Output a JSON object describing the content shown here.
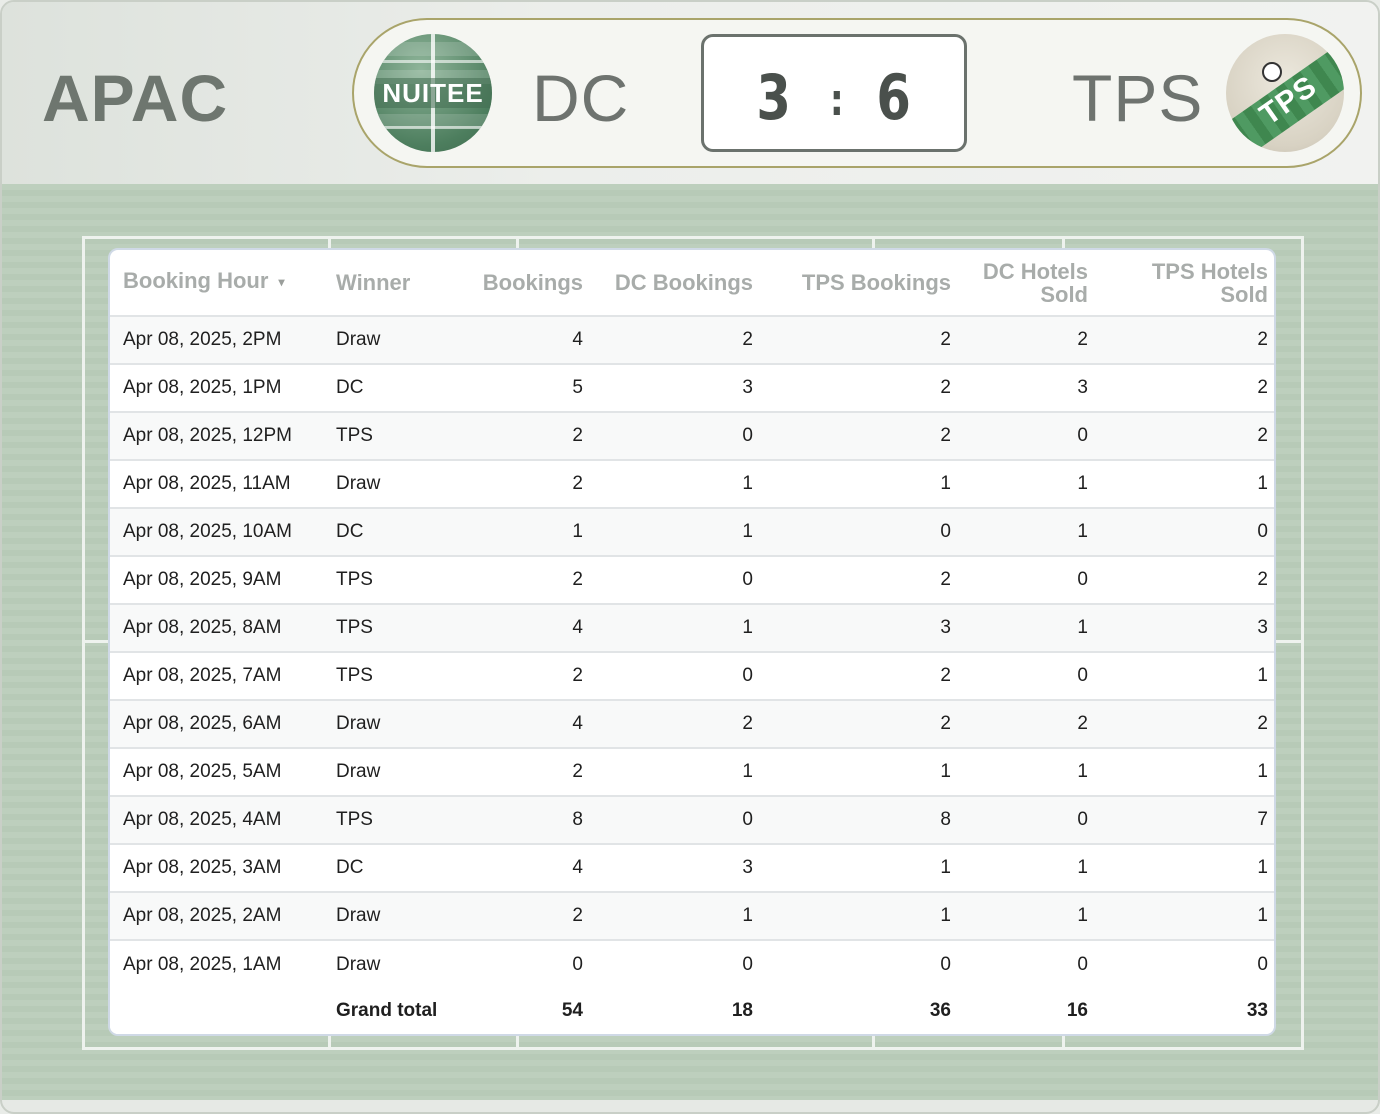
{
  "header": {
    "region": "APAC",
    "team_left": "DC",
    "team_right": "TPS",
    "score_left": "3",
    "score_separator": ":",
    "score_right": "6",
    "logo_left_text": "NUITEE",
    "logo_right_text": "TPS"
  },
  "table": {
    "columns": [
      "Booking Hour",
      "Winner",
      "Bookings",
      "DC Bookings",
      "TPS Bookings",
      "DC Hotels Sold",
      "TPS Hotels Sold"
    ],
    "sort_indicator": "▾",
    "rows": [
      [
        "Apr 08, 2025, 2PM",
        "Draw",
        "4",
        "2",
        "2",
        "2",
        "2"
      ],
      [
        "Apr 08, 2025, 1PM",
        "DC",
        "5",
        "3",
        "2",
        "3",
        "2"
      ],
      [
        "Apr 08, 2025, 12PM",
        "TPS",
        "2",
        "0",
        "2",
        "0",
        "2"
      ],
      [
        "Apr 08, 2025, 11AM",
        "Draw",
        "2",
        "1",
        "1",
        "1",
        "1"
      ],
      [
        "Apr 08, 2025, 10AM",
        "DC",
        "1",
        "1",
        "0",
        "1",
        "0"
      ],
      [
        "Apr 08, 2025, 9AM",
        "TPS",
        "2",
        "0",
        "2",
        "0",
        "2"
      ],
      [
        "Apr 08, 2025, 8AM",
        "TPS",
        "4",
        "1",
        "3",
        "1",
        "3"
      ],
      [
        "Apr 08, 2025, 7AM",
        "TPS",
        "2",
        "0",
        "2",
        "0",
        "1"
      ],
      [
        "Apr 08, 2025, 6AM",
        "Draw",
        "4",
        "2",
        "2",
        "2",
        "2"
      ],
      [
        "Apr 08, 2025, 5AM",
        "Draw",
        "2",
        "1",
        "1",
        "1",
        "1"
      ],
      [
        "Apr 08, 2025, 4AM",
        "TPS",
        "8",
        "0",
        "8",
        "0",
        "7"
      ],
      [
        "Apr 08, 2025, 3AM",
        "DC",
        "4",
        "3",
        "1",
        "1",
        "1"
      ],
      [
        "Apr 08, 2025, 2AM",
        "Draw",
        "2",
        "1",
        "1",
        "1",
        "1"
      ],
      [
        "Apr 08, 2025, 1AM",
        "Draw",
        "0",
        "0",
        "0",
        "0",
        "0"
      ]
    ],
    "total": {
      "label": "Grand total",
      "values": [
        "54",
        "18",
        "36",
        "16",
        "33"
      ]
    }
  },
  "colors": {
    "pitch": "#bdcfbd",
    "score_border": "#a9a46a",
    "header_text": "#a8acaa"
  }
}
